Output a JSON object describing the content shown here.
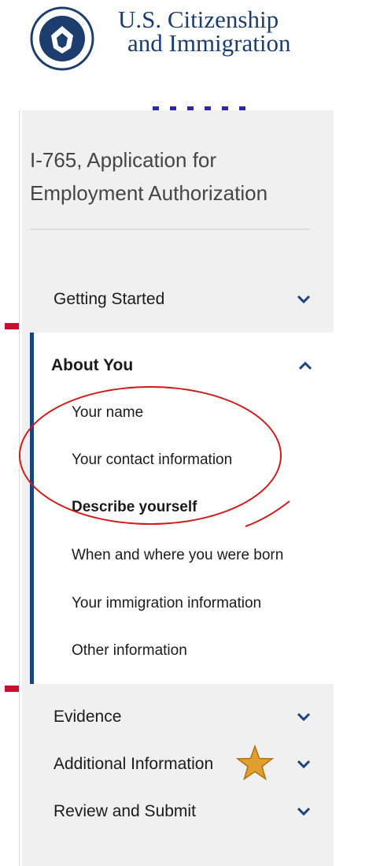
{
  "header": {
    "agency_line1": "U.S. Citizenship",
    "agency_line2": "and Immigration"
  },
  "sidenav": {
    "form_title": "I-765, Application for Employment Authorization",
    "sections": {
      "getting_started": "Getting Started",
      "about_you": "About You",
      "evidence": "Evidence",
      "additional_information": "Additional Information",
      "review_and_submit": "Review and Submit"
    },
    "about_you_items": {
      "your_name": "Your name",
      "your_contact_information": "Your contact information",
      "describe_yourself": "Describe yourself",
      "when_and_where_born": "When and where you were born",
      "your_immigration_information": "Your immigration information",
      "other_information": "Other information"
    }
  },
  "colors": {
    "active_border": "#1a4480",
    "sidenav_background": "#f0f0f0",
    "annotation_red": "#d11a1a",
    "annotation_star": "#e0a030",
    "chevron": "#1a4480"
  }
}
